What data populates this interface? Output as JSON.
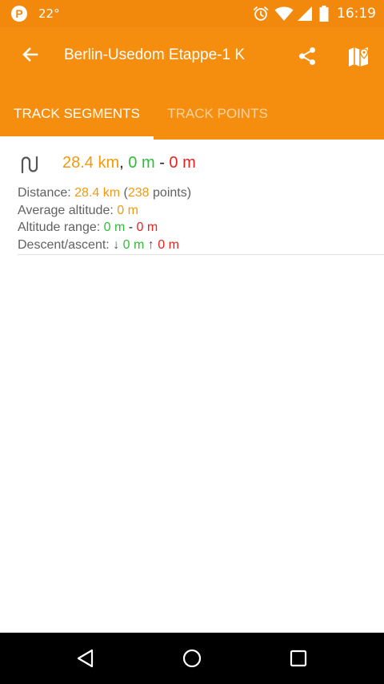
{
  "status_bar": {
    "temperature": "22°",
    "time": "16:19"
  },
  "app_bar": {
    "title": "Berlin-Usedom Etappe-1 K"
  },
  "tabs": [
    {
      "label": "TRACK SEGMENTS",
      "active": true
    },
    {
      "label": "TRACK POINTS",
      "active": false
    }
  ],
  "segment": {
    "header": {
      "distance": "28.4 km",
      "comma": ",",
      "min_altitude": "0 m",
      "dash": "-",
      "max_altitude": "0 m"
    },
    "distance_row": {
      "label": "Distance:",
      "value": "28.4 km",
      "open": "(",
      "points_count": "238",
      "points_word": "points)"
    },
    "avg_altitude_row": {
      "label": "Average altitude:",
      "value": "0 m"
    },
    "altitude_range_row": {
      "label": "Altitude range:",
      "min": "0 m",
      "dash": "-",
      "max": "0 m"
    },
    "descent_ascent_row": {
      "label": "Descent/ascent:",
      "down_arrow": "↓",
      "descent": "0 m",
      "up_arrow": "↑",
      "ascent": "0 m"
    }
  },
  "colors": {
    "primary": "#f58e0f",
    "status_bar": "#f2880c",
    "distance": "#f29a0c",
    "min_altitude": "#2fbd37",
    "max_altitude": "#e8231e"
  },
  "icons": {
    "status_left": [
      "pinterest-icon"
    ],
    "status_right": [
      "alarm-icon",
      "wifi-icon",
      "cell-signal-icon",
      "battery-icon"
    ],
    "app_bar": [
      "back-arrow-icon",
      "share-icon",
      "map-pin-icon"
    ],
    "segment": "track-route-icon",
    "nav": [
      "nav-back-icon",
      "nav-home-icon",
      "nav-recents-icon"
    ]
  }
}
